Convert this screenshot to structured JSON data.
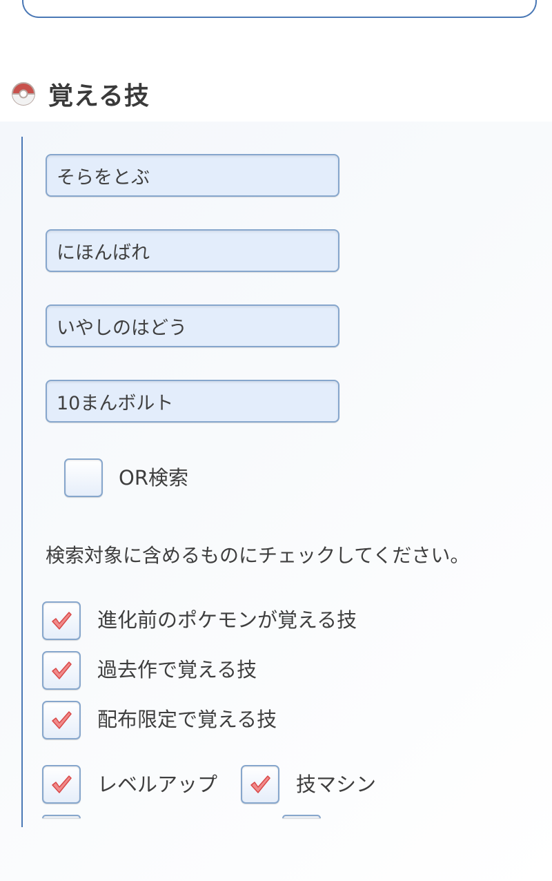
{
  "section": {
    "title": "覚える技",
    "icon": "pokeball-icon"
  },
  "moves": {
    "inputs": [
      {
        "value": "そらをとぶ"
      },
      {
        "value": "にほんばれ"
      },
      {
        "value": "いやしのはどう"
      },
      {
        "value": "10まんボルト"
      }
    ]
  },
  "or_search": {
    "label": "OR検索",
    "checked": false
  },
  "instruction": "検索対象に含めるものにチェックしてください。",
  "options": [
    {
      "label": "進化前のポケモンが覚える技",
      "checked": true
    },
    {
      "label": "過去作で覚える技",
      "checked": true
    },
    {
      "label": "配布限定で覚える技",
      "checked": true
    }
  ],
  "sources": [
    {
      "label": "レベルアップ",
      "checked": true
    },
    {
      "label": "技マシン",
      "checked": true
    }
  ],
  "colors": {
    "accent_border": "#4a78b5",
    "input_bg": "#e3edfb",
    "check_red": "#e05555"
  }
}
